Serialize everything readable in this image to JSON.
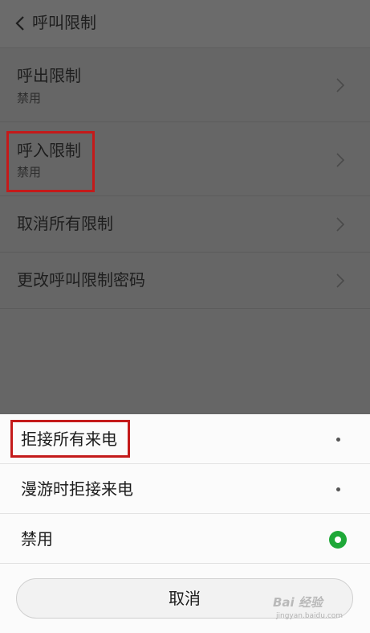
{
  "header": {
    "title": "呼叫限制",
    "back_icon": "chevron-left-icon"
  },
  "rows": [
    {
      "title": "呼出限制",
      "subtitle": "禁用"
    },
    {
      "title": "呼入限制",
      "subtitle": "禁用"
    },
    {
      "title": "取消所有限制"
    },
    {
      "title": "更改呼叫限制密码"
    }
  ],
  "sheet": {
    "options": [
      {
        "label": "拒接所有来电",
        "selected": false
      },
      {
        "label": "漫游时拒接来电",
        "selected": false
      },
      {
        "label": "禁用",
        "selected": true
      }
    ],
    "cancel_label": "取消"
  },
  "watermark": {
    "text": "Bai 经验",
    "sub": "jingyan.baidu.com"
  },
  "colors": {
    "highlight": "#c41a1a",
    "selected_radio": "#1ea838",
    "overlay": "#666666"
  }
}
